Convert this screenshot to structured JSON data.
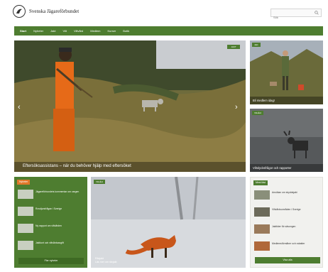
{
  "header": {
    "site_name": "Svenska Jägareförbundet",
    "search_placeholder": "Sök"
  },
  "nav": {
    "items": [
      "Start",
      "Nyheter",
      "Jakt",
      "Vilt",
      "Viltvård",
      "Medlem",
      "Kurser",
      "Butik"
    ]
  },
  "hero": {
    "badge": "JAKT",
    "caption": "Eftersöksassistans – när du behöver hjälp med eftersöket"
  },
  "side_cards": [
    {
      "tag": "Jakt",
      "caption": "Bli medlem idag!"
    },
    {
      "tag": "Viltvård",
      "caption": "Viltolycksfrågor och rapporter"
    }
  ],
  "news": {
    "heading": "Nyheter",
    "items": [
      "Jägareförbundets kommentar om vargen",
      "Rovdjursfrågan i Sverige",
      "Ny rapport om viltvården",
      "Jaktkort och viltvårdsavgift"
    ],
    "more": "Fler nyheter"
  },
  "fox_card": {
    "tag": "Viltvård",
    "caption_line1": "Rävjakt",
    "caption_line2": "Läs mer om rävjakt"
  },
  "right_list": {
    "heading": "Mest läst",
    "items": [
      "Ansökan om skyddsjakt",
      "Viltvårdsområden i Sverige",
      "Jakttider för säsongen",
      "Medlemsförmåner och rabatter"
    ],
    "more": "Visa alla"
  },
  "colors": {
    "brand_green": "#4e7d30",
    "accent_orange": "#e0782a"
  }
}
